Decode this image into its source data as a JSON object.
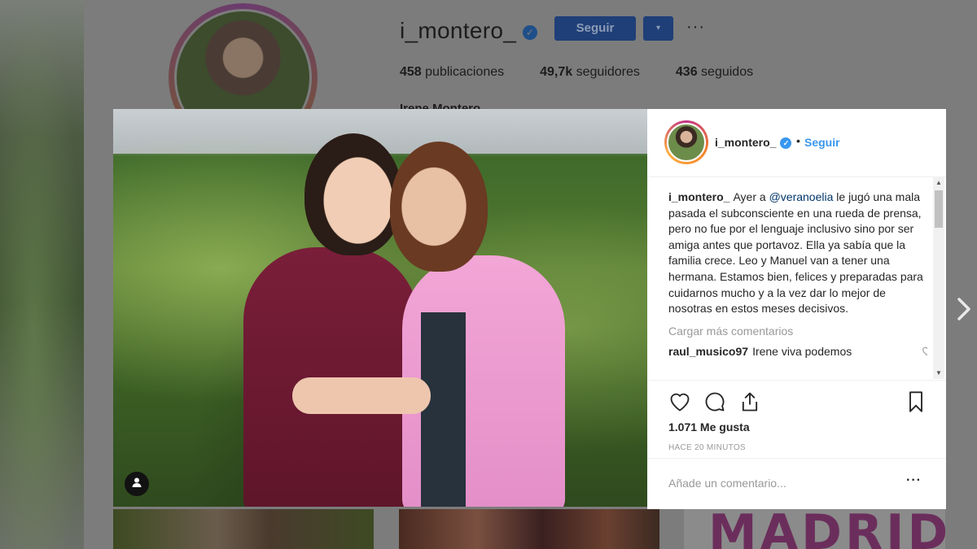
{
  "profile": {
    "username": "i_montero_",
    "follow_label": "Seguir",
    "dropdown_icon": "▾",
    "more_icon": "···",
    "stats": {
      "posts_count": "458",
      "posts_label": "publicaciones",
      "followers_count": "49,7k",
      "followers_label": "seguidores",
      "following_count": "436",
      "following_label": "seguidos"
    },
    "full_name": "Irene Montero"
  },
  "thumbnails": [
    {
      "text": ""
    },
    {
      "text": ""
    },
    {
      "text": "MADRID"
    }
  ],
  "post": {
    "username": "i_montero_",
    "separator": "•",
    "follow_label": "Seguir",
    "caption": {
      "user": "i_montero_",
      "text_before": "Ayer a ",
      "mention": "@veranoelia",
      "text_after": " le jugó una mala pasada el subconsciente en una rueda de prensa, pero no fue por el lenguaje inclusivo sino por ser amiga antes que portavoz. Ella ya sabía que la familia crece. Leo y Manuel van a tener una hermana. Estamos bien, felices y preparadas para cuidarnos mucho y a la vez dar lo mejor de nosotras en estos meses decisivos."
    },
    "load_more": "Cargar más comentarios",
    "comments": [
      {
        "user": "raul_musico97",
        "text": "Irene viva podemos"
      }
    ],
    "likes": "1.071 Me gusta",
    "time": "HACE 20 MINUTOS",
    "add_comment_placeholder": "Añade un comentario...",
    "more_icon": "···"
  },
  "icons": {
    "verified": "checkmark-badge",
    "like": "heart-outline",
    "comment": "speech-bubble-outline",
    "share": "share-outline",
    "save": "bookmark-outline",
    "user_tag": "person-silhouette",
    "next": "chevron-right"
  },
  "colors": {
    "accent": "#3897f0",
    "text": "#262626",
    "muted": "#999999"
  }
}
